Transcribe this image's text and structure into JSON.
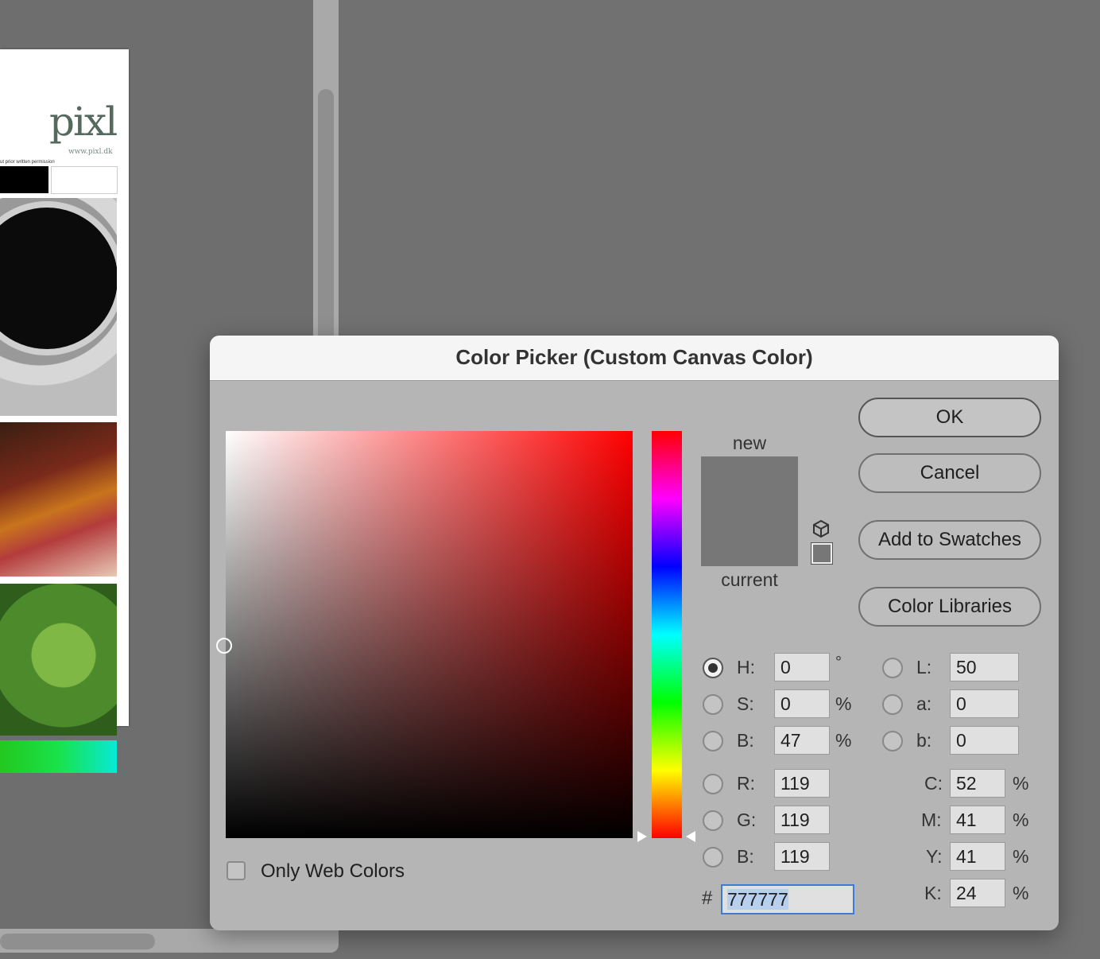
{
  "background": {
    "document": {
      "logo_text": "pixl",
      "logo_url": "www.pixl.dk",
      "permission_text": "ut prior written permission"
    }
  },
  "dialog": {
    "title": "Color Picker (Custom Canvas Color)",
    "swatch": {
      "new_label": "new",
      "current_label": "current",
      "new_color": "#777777",
      "current_color": "#777777"
    },
    "buttons": {
      "ok": "OK",
      "cancel": "Cancel",
      "add_to_swatches": "Add to Swatches",
      "color_libraries": "Color Libraries"
    },
    "hsb": {
      "h_label": "H:",
      "h_value": "0",
      "h_unit": "°",
      "s_label": "S:",
      "s_value": "0",
      "s_unit": "%",
      "b_label": "B:",
      "b_value": "47",
      "b_unit": "%"
    },
    "rgb": {
      "r_label": "R:",
      "r_value": "119",
      "g_label": "G:",
      "g_value": "119",
      "b_label": "B:",
      "b_value": "119"
    },
    "lab": {
      "l_label": "L:",
      "l_value": "50",
      "a_label": "a:",
      "a_value": "0",
      "b_label": "b:",
      "b_value": "0"
    },
    "cmyk": {
      "c_label": "C:",
      "c_value": "52",
      "m_label": "M:",
      "m_value": "41",
      "y_label": "Y:",
      "y_value": "41",
      "k_label": "K:",
      "k_value": "24",
      "unit": "%"
    },
    "hex": {
      "hash": "#",
      "value": "777777"
    },
    "only_web_colors": {
      "label": "Only Web Colors",
      "checked": false
    },
    "selected_mode": "H",
    "hue_color": "#ff0000"
  }
}
